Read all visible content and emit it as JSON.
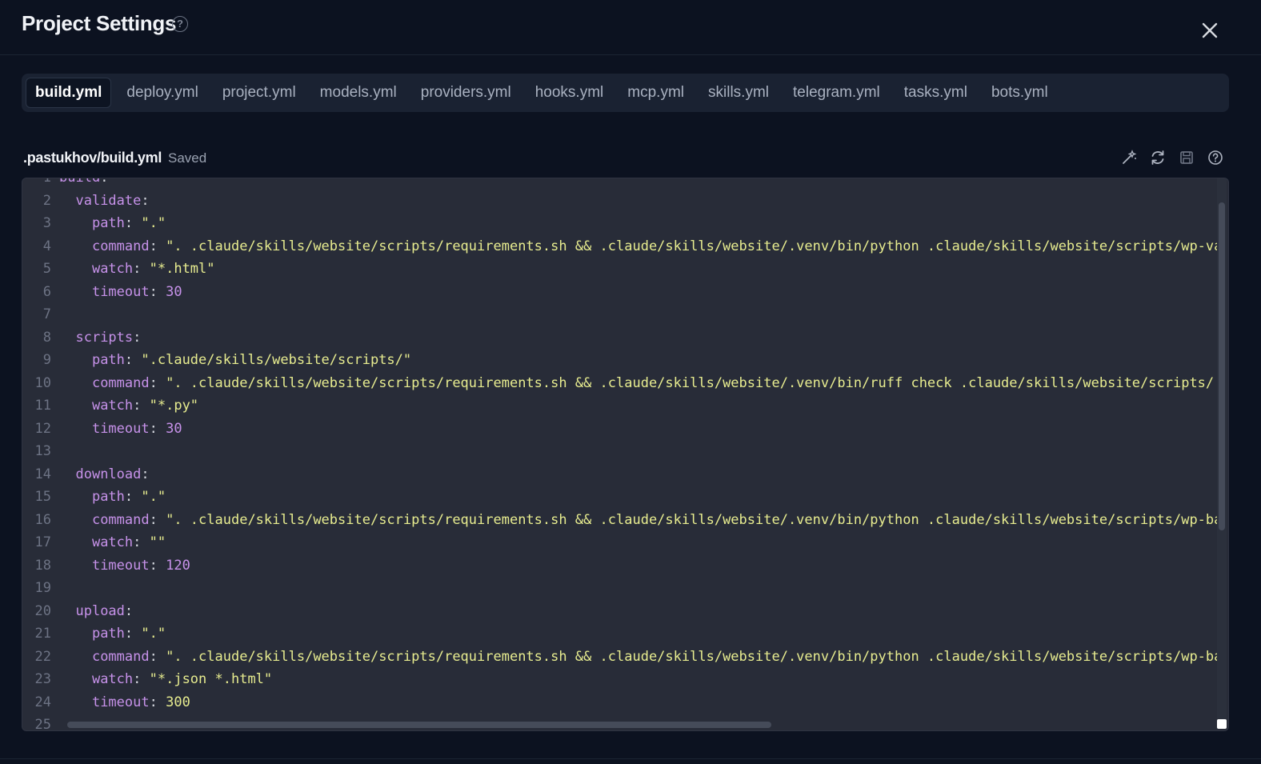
{
  "header": {
    "title": "Project Settings",
    "help_glyph": "?"
  },
  "tabs": [
    {
      "label": "build.yml",
      "active": true
    },
    {
      "label": "deploy.yml",
      "active": false
    },
    {
      "label": "project.yml",
      "active": false
    },
    {
      "label": "models.yml",
      "active": false
    },
    {
      "label": "providers.yml",
      "active": false
    },
    {
      "label": "hooks.yml",
      "active": false
    },
    {
      "label": "mcp.yml",
      "active": false
    },
    {
      "label": "skills.yml",
      "active": false
    },
    {
      "label": "telegram.yml",
      "active": false
    },
    {
      "label": "tasks.yml",
      "active": false
    },
    {
      "label": "bots.yml",
      "active": false
    }
  ],
  "file": {
    "path": ".pastukhov/build.yml",
    "status": "Saved"
  },
  "toolbar_icons": [
    "magic-wand-icon",
    "refresh-icon",
    "save-icon",
    "help-icon"
  ],
  "code_lines": [
    {
      "n": "1",
      "parts": [
        [
          "k",
          "build"
        ],
        [
          "p",
          ":"
        ]
      ]
    },
    {
      "n": "2",
      "parts": [
        [
          "p",
          "  "
        ],
        [
          "k",
          "validate"
        ],
        [
          "p",
          ":"
        ]
      ]
    },
    {
      "n": "3",
      "parts": [
        [
          "p",
          "    "
        ],
        [
          "k",
          "path"
        ],
        [
          "p",
          ": "
        ],
        [
          "s",
          "\".\""
        ]
      ]
    },
    {
      "n": "4",
      "parts": [
        [
          "p",
          "    "
        ],
        [
          "k",
          "command"
        ],
        [
          "p",
          ": "
        ],
        [
          "s",
          "\". .claude/skills/website/scripts/requirements.sh && .claude/skills/website/.venv/bin/python .claude/skills/website/scripts/wp-validate.p"
        ]
      ]
    },
    {
      "n": "5",
      "parts": [
        [
          "p",
          "    "
        ],
        [
          "k",
          "watch"
        ],
        [
          "p",
          ": "
        ],
        [
          "s",
          "\"*.html\""
        ]
      ]
    },
    {
      "n": "6",
      "parts": [
        [
          "p",
          "    "
        ],
        [
          "k",
          "timeout"
        ],
        [
          "p",
          ": "
        ],
        [
          "n",
          "30"
        ]
      ]
    },
    {
      "n": "7",
      "parts": []
    },
    {
      "n": "8",
      "parts": [
        [
          "p",
          "  "
        ],
        [
          "k",
          "scripts"
        ],
        [
          "p",
          ":"
        ]
      ]
    },
    {
      "n": "9",
      "parts": [
        [
          "p",
          "    "
        ],
        [
          "k",
          "path"
        ],
        [
          "p",
          ": "
        ],
        [
          "s",
          "\".claude/skills/website/scripts/\""
        ]
      ]
    },
    {
      "n": "10",
      "parts": [
        [
          "p",
          "    "
        ],
        [
          "k",
          "command"
        ],
        [
          "p",
          ": "
        ],
        [
          "s",
          "\". .claude/skills/website/scripts/requirements.sh && .claude/skills/website/.venv/bin/ruff check .claude/skills/website/scripts/ && .clau"
        ]
      ]
    },
    {
      "n": "11",
      "parts": [
        [
          "p",
          "    "
        ],
        [
          "k",
          "watch"
        ],
        [
          "p",
          ": "
        ],
        [
          "s",
          "\"*.py\""
        ]
      ]
    },
    {
      "n": "12",
      "parts": [
        [
          "p",
          "    "
        ],
        [
          "k",
          "timeout"
        ],
        [
          "p",
          ": "
        ],
        [
          "n",
          "30"
        ]
      ]
    },
    {
      "n": "13",
      "parts": []
    },
    {
      "n": "14",
      "parts": [
        [
          "p",
          "  "
        ],
        [
          "k",
          "download"
        ],
        [
          "p",
          ":"
        ]
      ]
    },
    {
      "n": "15",
      "parts": [
        [
          "p",
          "    "
        ],
        [
          "k",
          "path"
        ],
        [
          "p",
          ": "
        ],
        [
          "s",
          "\".\""
        ]
      ]
    },
    {
      "n": "16",
      "parts": [
        [
          "p",
          "    "
        ],
        [
          "k",
          "command"
        ],
        [
          "p",
          ": "
        ],
        [
          "s",
          "\". .claude/skills/website/scripts/requirements.sh && .claude/skills/website/.venv/bin/python .claude/skills/website/scripts/wp-backup.py"
        ]
      ]
    },
    {
      "n": "17",
      "parts": [
        [
          "p",
          "    "
        ],
        [
          "k",
          "watch"
        ],
        [
          "p",
          ": "
        ],
        [
          "s",
          "\"\""
        ]
      ]
    },
    {
      "n": "18",
      "parts": [
        [
          "p",
          "    "
        ],
        [
          "k",
          "timeout"
        ],
        [
          "p",
          ": "
        ],
        [
          "n",
          "120"
        ]
      ]
    },
    {
      "n": "19",
      "parts": []
    },
    {
      "n": "20",
      "parts": [
        [
          "p",
          "  "
        ],
        [
          "k",
          "upload"
        ],
        [
          "p",
          ":"
        ]
      ]
    },
    {
      "n": "21",
      "parts": [
        [
          "p",
          "    "
        ],
        [
          "k",
          "path"
        ],
        [
          "p",
          ": "
        ],
        [
          "s",
          "\".\""
        ]
      ]
    },
    {
      "n": "22",
      "parts": [
        [
          "p",
          "    "
        ],
        [
          "k",
          "command"
        ],
        [
          "p",
          ": "
        ],
        [
          "s",
          "\". .claude/skills/website/scripts/requirements.sh && .claude/skills/website/.venv/bin/python .claude/skills/website/scripts/wp-backup.py"
        ]
      ]
    },
    {
      "n": "23",
      "parts": [
        [
          "p",
          "    "
        ],
        [
          "k",
          "watch"
        ],
        [
          "p",
          ": "
        ],
        [
          "s",
          "\"*.json *.html\""
        ]
      ]
    },
    {
      "n": "24",
      "parts": [
        [
          "p",
          "    "
        ],
        [
          "k",
          "timeout"
        ],
        [
          "p",
          ": "
        ],
        [
          "w",
          "300"
        ]
      ]
    },
    {
      "n": "25",
      "parts": []
    }
  ],
  "colors": {
    "background": "#0c1220",
    "tab_bar": "#1a2232",
    "editor_bg": "#282c38",
    "key": "#c792ea",
    "string": "#e7ec8f"
  }
}
